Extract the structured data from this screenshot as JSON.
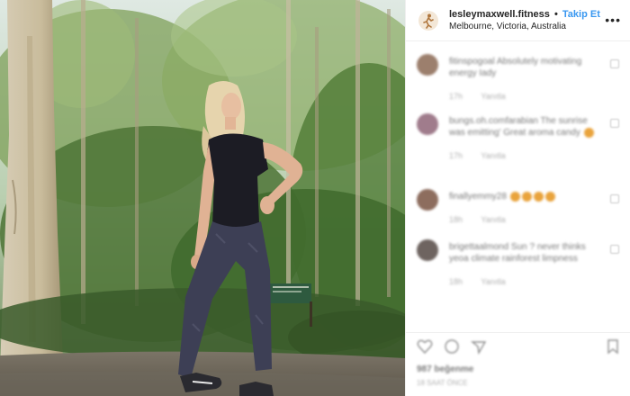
{
  "post": {
    "username": "lesleymaxwell.fitness",
    "separator": "•",
    "follow_label": "Takip Et",
    "location": "Melbourne, Victoria, Australia",
    "more_icon": "•••"
  },
  "comments": [
    {
      "text": "fitinspogoal Absolutely motivating energy Iady",
      "meta1": "17h",
      "meta2": "Yanıtla"
    },
    {
      "text": "bungs.oh.comfarabian The sunrise was emitting' Great aroma candy",
      "meta1": "17h",
      "meta2": "Yanıtla"
    },
    {
      "text": "finallyemmy28",
      "meta1": "18h",
      "meta2": "Yanıtla"
    },
    {
      "text": "brigettaalmond Sun ? never thinks yeoa climate rainforest limpness",
      "meta1": "18h",
      "meta2": "Yanıtla"
    }
  ],
  "footer": {
    "likes": "987 beğenme",
    "date": "18 SAAT ÖNCE"
  },
  "colors": {
    "accent": "#3897f0",
    "text": "#262626"
  }
}
